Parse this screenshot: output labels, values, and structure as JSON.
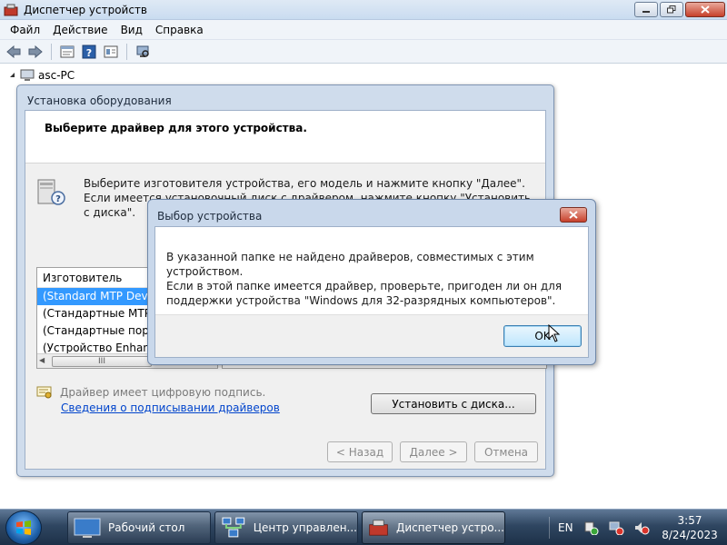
{
  "main_window": {
    "title": "Диспетчер устройств",
    "controls": [
      "minimize",
      "maximize",
      "close"
    ]
  },
  "menu": [
    "Файл",
    "Действие",
    "Вид",
    "Справка"
  ],
  "toolbar": {
    "icons": [
      "back-arrow-icon",
      "forward-arrow-icon",
      "properties-icon",
      "help-icon",
      "view-icon",
      "scan-hardware-icon"
    ]
  },
  "tree": {
    "root_label": "asc-PC"
  },
  "wizard": {
    "title": "Установка оборудования",
    "heading": "Выберите драйвер для этого устройства.",
    "description": "Выберите изготовителя устройства, его модель и нажмите кнопку \"Далее\". Если имеется установочный диск с  драйвером, нажмите кнопку \"Установить с диска\".",
    "manufacturer_header": "Изготовитель",
    "manufacturers": [
      "(Standard MTP Device)",
      "(Стандартные MTP-с",
      "(Стандартные порты)",
      "(Устройство Enhance"
    ],
    "scroll_thumb_glyph": "III",
    "signed_text": "Драйвер имеет цифровую подпись.",
    "signing_link": "Сведения о подписывании драйверов",
    "install_button": "Установить с диска...",
    "back_button": "< Назад",
    "next_button": "Далее >",
    "cancel_button": "Отмена"
  },
  "dialog": {
    "title": "Выбор устройства",
    "message_line1": "В указанной папке не найдено драйверов, совместимых с этим устройством.",
    "message_line2": "Если в этой папке имеется драйвер, проверьте, пригоден ли он для",
    "message_line3": "поддержки устройства \"Windows для 32-разрядных компьютеров\".",
    "ok_button": "OK"
  },
  "taskbar": {
    "tasks": [
      {
        "label": "Рабочий стол"
      },
      {
        "label": "Центр управлен..."
      },
      {
        "label": "Диспетчер устро..."
      }
    ],
    "language": "EN",
    "time": "3:57",
    "date": "8/24/2023"
  },
  "colors": {
    "selection": "#3399ff",
    "link": "#0044cc",
    "taskbar": "#2f4661"
  }
}
